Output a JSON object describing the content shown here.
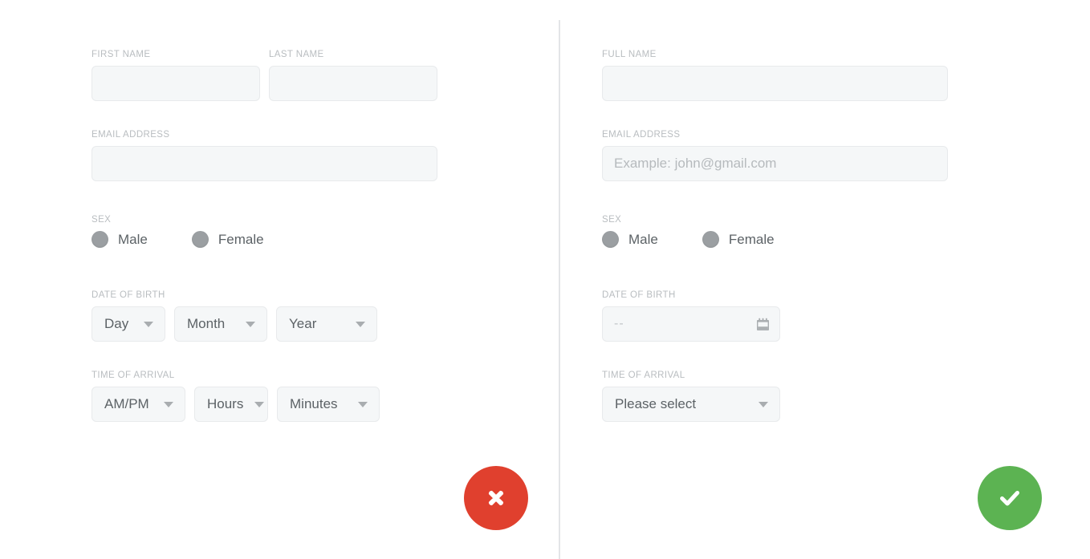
{
  "divider": {
    "color": "#e3e5e7"
  },
  "left_form": {
    "first_name": {
      "label": "FIRST NAME",
      "value": "",
      "placeholder": ""
    },
    "last_name": {
      "label": "LAST NAME",
      "value": "",
      "placeholder": ""
    },
    "email": {
      "label": "EMAIL ADDRESS",
      "value": "",
      "placeholder": ""
    },
    "sex": {
      "label": "SEX",
      "options": [
        {
          "label": "Male",
          "selected": false
        },
        {
          "label": "Female",
          "selected": false
        }
      ]
    },
    "date_of_birth": {
      "label": "DATE OF BIRTH",
      "selects": [
        {
          "value": "Day",
          "name": "day"
        },
        {
          "value": "Month",
          "name": "month"
        },
        {
          "value": "Year",
          "name": "year"
        }
      ]
    },
    "time_of_arrival": {
      "label": "TIME OF ARRIVAL",
      "selects": [
        {
          "value": "AM/PM",
          "name": "ampm"
        },
        {
          "value": "Hours",
          "name": "hours"
        },
        {
          "value": "Minutes",
          "name": "minutes"
        }
      ]
    },
    "action": {
      "icon": "close-icon",
      "color": "#e0402e"
    }
  },
  "right_form": {
    "full_name": {
      "label": "FULL NAME",
      "value": "",
      "placeholder": ""
    },
    "email": {
      "label": "EMAIL ADDRESS",
      "value": "",
      "placeholder": "Example: john@gmail.com"
    },
    "sex": {
      "label": "SEX",
      "options": [
        {
          "label": "Male",
          "selected": false
        },
        {
          "label": "Female",
          "selected": false
        }
      ]
    },
    "date_of_birth": {
      "label": "DATE OF BIRTH",
      "placeholder": "--",
      "icon": "calendar-icon"
    },
    "time_of_arrival": {
      "label": "TIME OF ARRIVAL",
      "select": {
        "value": "Please select"
      }
    },
    "action": {
      "icon": "check-icon",
      "color": "#5cb352"
    }
  },
  "colors": {
    "field_bg": "#f5f7f8",
    "field_border": "#e8eaec",
    "label_text": "#b9bdc0",
    "value_text": "#5c6266",
    "placeholder_text": "#b6babd",
    "radio_fill": "#9b9fa2",
    "cancel_red": "#e0402e",
    "submit_green": "#5cb352"
  }
}
